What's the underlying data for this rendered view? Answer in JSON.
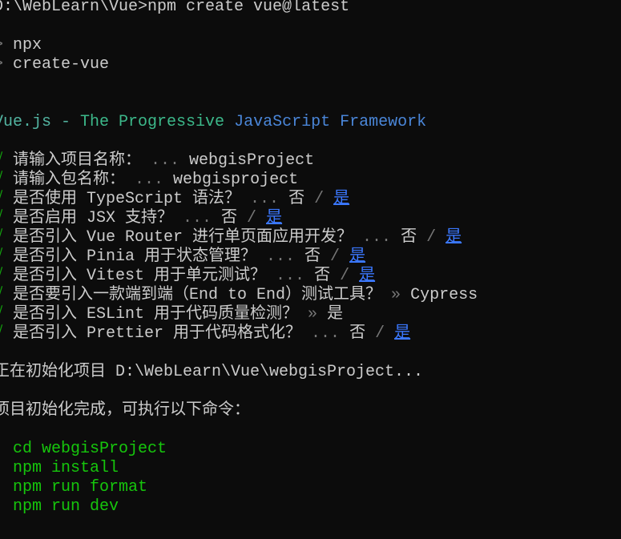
{
  "colors": {
    "background": "#0c0c0c",
    "text": "#cccccc",
    "success": "#13a10e",
    "command": "#16c60c",
    "dim": "#767676",
    "selected": "#3b78ff"
  },
  "lines": [
    [
      {
        "t": "D:\\WebLearn\\Vue>npm create vue@latest",
        "s": "n"
      }
    ],
    [],
    [
      {
        "t": "> ",
        "s": "d"
      },
      {
        "t": "npx",
        "s": "n"
      }
    ],
    [
      {
        "t": "> ",
        "s": "d"
      },
      {
        "t": "create-vue",
        "s": "n"
      }
    ],
    [],
    [],
    [
      {
        "t": "Vue.js - ",
        "s": "t1"
      },
      {
        "t": "The Progressive ",
        "s": "t2"
      },
      {
        "t": "JavaScript Framework",
        "s": "t3"
      }
    ],
    [],
    [
      {
        "t": "√ ",
        "s": "ok"
      },
      {
        "t": "请输入项目名称： ",
        "s": "n"
      },
      {
        "t": "... ",
        "s": "d"
      },
      {
        "t": "webgisProject",
        "s": "n"
      }
    ],
    [
      {
        "t": "√ ",
        "s": "ok"
      },
      {
        "t": "请输入包名称： ",
        "s": "n"
      },
      {
        "t": "... ",
        "s": "d"
      },
      {
        "t": "webgisproject",
        "s": "n"
      }
    ],
    [
      {
        "t": "√ ",
        "s": "ok"
      },
      {
        "t": "是否使用 TypeScript 语法？ ",
        "s": "n"
      },
      {
        "t": "... ",
        "s": "d"
      },
      {
        "t": "否",
        "s": "n"
      },
      {
        "t": " / ",
        "s": "d"
      },
      {
        "t": "是",
        "s": "l"
      }
    ],
    [
      {
        "t": "√ ",
        "s": "ok"
      },
      {
        "t": "是否启用 JSX 支持？ ",
        "s": "n"
      },
      {
        "t": "... ",
        "s": "d"
      },
      {
        "t": "否",
        "s": "n"
      },
      {
        "t": " / ",
        "s": "d"
      },
      {
        "t": "是",
        "s": "l"
      }
    ],
    [
      {
        "t": "√ ",
        "s": "ok"
      },
      {
        "t": "是否引入 Vue Router 进行单页面应用开发？ ",
        "s": "n"
      },
      {
        "t": "... ",
        "s": "d"
      },
      {
        "t": "否",
        "s": "n"
      },
      {
        "t": " / ",
        "s": "d"
      },
      {
        "t": "是",
        "s": "l"
      }
    ],
    [
      {
        "t": "√ ",
        "s": "ok"
      },
      {
        "t": "是否引入 Pinia 用于状态管理？ ",
        "s": "n"
      },
      {
        "t": "... ",
        "s": "d"
      },
      {
        "t": "否",
        "s": "n"
      },
      {
        "t": " / ",
        "s": "d"
      },
      {
        "t": "是",
        "s": "l"
      }
    ],
    [
      {
        "t": "√ ",
        "s": "ok"
      },
      {
        "t": "是否引入 Vitest 用于单元测试？ ",
        "s": "n"
      },
      {
        "t": "... ",
        "s": "d"
      },
      {
        "t": "否",
        "s": "n"
      },
      {
        "t": " / ",
        "s": "d"
      },
      {
        "t": "是",
        "s": "l"
      }
    ],
    [
      {
        "t": "√ ",
        "s": "ok"
      },
      {
        "t": "是否要引入一款端到端（End to End）测试工具？ ",
        "s": "n"
      },
      {
        "t": "» ",
        "s": "d"
      },
      {
        "t": "Cypress",
        "s": "n"
      }
    ],
    [
      {
        "t": "√ ",
        "s": "ok"
      },
      {
        "t": "是否引入 ESLint 用于代码质量检测？ ",
        "s": "n"
      },
      {
        "t": "» ",
        "s": "d"
      },
      {
        "t": "是",
        "s": "n"
      }
    ],
    [
      {
        "t": "√ ",
        "s": "ok"
      },
      {
        "t": "是否引入 Prettier 用于代码格式化？ ",
        "s": "n"
      },
      {
        "t": "... ",
        "s": "d"
      },
      {
        "t": "否",
        "s": "n"
      },
      {
        "t": " / ",
        "s": "d"
      },
      {
        "t": "是",
        "s": "l"
      }
    ],
    [],
    [
      {
        "t": "正在初始化项目 D:\\WebLearn\\Vue\\webgisProject...",
        "s": "n"
      }
    ],
    [],
    [
      {
        "t": "项目初始化完成，可执行以下命令：",
        "s": "n"
      }
    ],
    [],
    [
      {
        "t": "  cd webgisProject",
        "s": "g"
      }
    ],
    [
      {
        "t": "  npm install",
        "s": "g"
      }
    ],
    [
      {
        "t": "  npm run format",
        "s": "g"
      }
    ],
    [
      {
        "t": "  npm run dev",
        "s": "g"
      }
    ]
  ]
}
